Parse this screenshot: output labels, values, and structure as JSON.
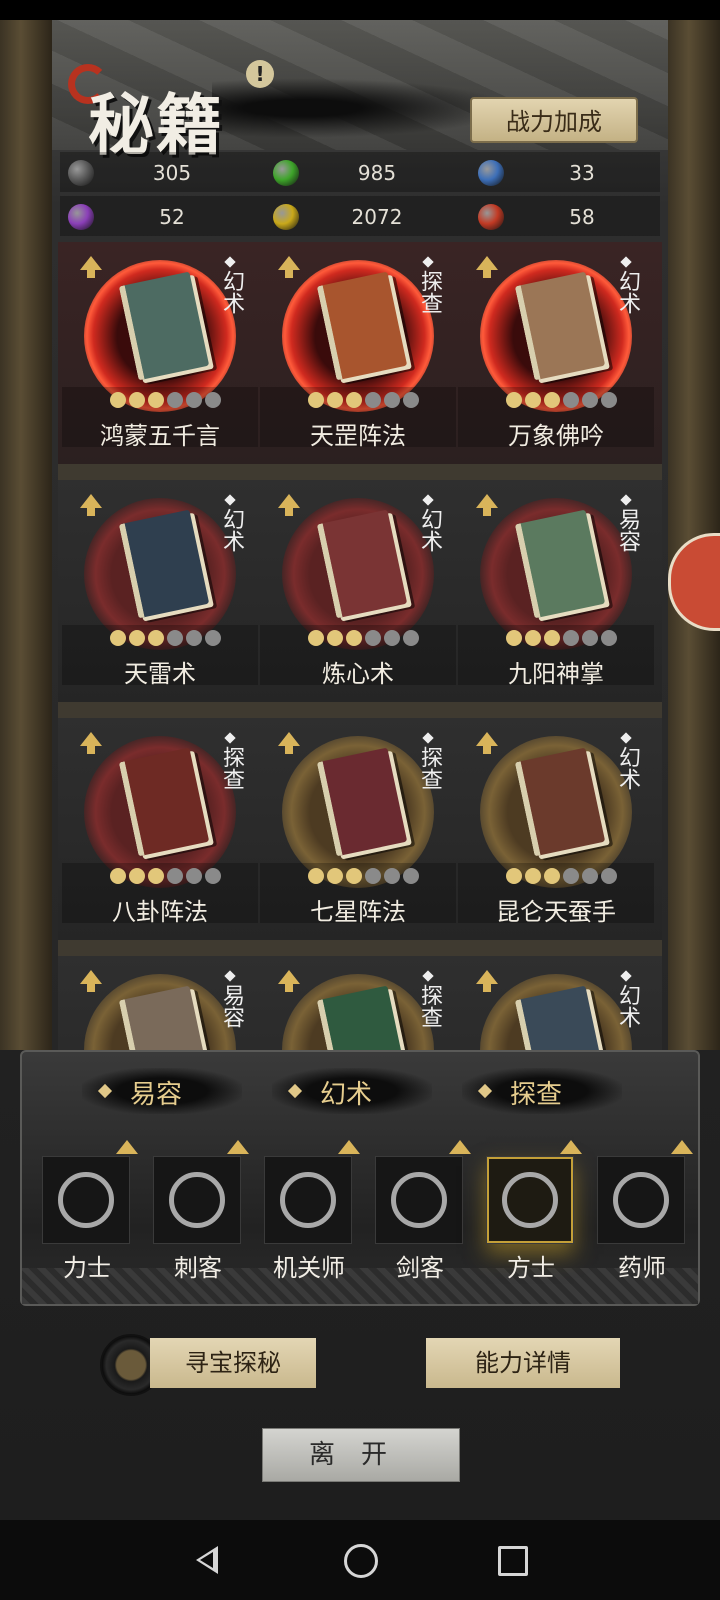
{
  "header": {
    "title": "秘籍",
    "notice_icon": "exclamation-icon",
    "power_button": "战力加成"
  },
  "resources": [
    {
      "color": "#5a5a5a",
      "value": "305"
    },
    {
      "color": "#3ea52a",
      "value": "985"
    },
    {
      "color": "#3d6fb8",
      "value": "33"
    },
    {
      "color": "#8b3fb8",
      "value": "52"
    },
    {
      "color": "#c9a91a",
      "value": "2072"
    },
    {
      "color": "#c23a24",
      "value": "58"
    }
  ],
  "books": [
    {
      "name": "鸿蒙五千言",
      "type": "幻术",
      "stars": 3,
      "max_stars": 6,
      "halo": "red",
      "cover": "#4d6b62"
    },
    {
      "name": "天罡阵法",
      "type": "探查",
      "stars": 3,
      "max_stars": 6,
      "halo": "red",
      "cover": "#a8552e"
    },
    {
      "name": "万象佛吟",
      "type": "幻术",
      "stars": 3,
      "max_stars": 6,
      "halo": "red",
      "cover": "#9b7656"
    },
    {
      "name": "天雷术",
      "type": "幻术",
      "stars": 3,
      "max_stars": 6,
      "halo": "maroon",
      "cover": "#2f3f4f"
    },
    {
      "name": "炼心术",
      "type": "幻术",
      "stars": 3,
      "max_stars": 6,
      "halo": "maroon",
      "cover": "#7a3434"
    },
    {
      "name": "九阳神掌",
      "type": "易容",
      "stars": 3,
      "max_stars": 6,
      "halo": "maroon",
      "cover": "#5b7a5f"
    },
    {
      "name": "八卦阵法",
      "type": "探查",
      "stars": 3,
      "max_stars": 6,
      "halo": "maroon",
      "cover": "#6e2a24"
    },
    {
      "name": "七星阵法",
      "type": "探查",
      "stars": 3,
      "max_stars": 6,
      "halo": "gold",
      "cover": "#6a2a30"
    },
    {
      "name": "昆仑天蚕手",
      "type": "幻术",
      "stars": 3,
      "max_stars": 6,
      "halo": "gold",
      "cover": "#6b3a2c"
    },
    {
      "name": "",
      "type": "易容",
      "stars": 0,
      "max_stars": 0,
      "halo": "gold",
      "cover": "#7a6a5a"
    },
    {
      "name": "",
      "type": "探查",
      "stars": 0,
      "max_stars": 0,
      "halo": "gold",
      "cover": "#2f5a3f"
    },
    {
      "name": "",
      "type": "幻术",
      "stars": 0,
      "max_stars": 0,
      "halo": "gold",
      "cover": "#3a4a58"
    }
  ],
  "filters": [
    "易容",
    "幻术",
    "探查"
  ],
  "classes": [
    {
      "name": "力士",
      "icon": "shield-icon",
      "active": false
    },
    {
      "name": "刺客",
      "icon": "dagger-icon",
      "active": false
    },
    {
      "name": "机关师",
      "icon": "gear-icon",
      "active": false
    },
    {
      "name": "剑客",
      "icon": "sword-icon",
      "active": false
    },
    {
      "name": "方士",
      "icon": "yin-yang-icon",
      "active": true
    },
    {
      "name": "药师",
      "icon": "dragon-icon",
      "active": false
    }
  ],
  "actions": {
    "treasure": "寻宝探秘",
    "details": "能力详情",
    "leave": "离开"
  }
}
